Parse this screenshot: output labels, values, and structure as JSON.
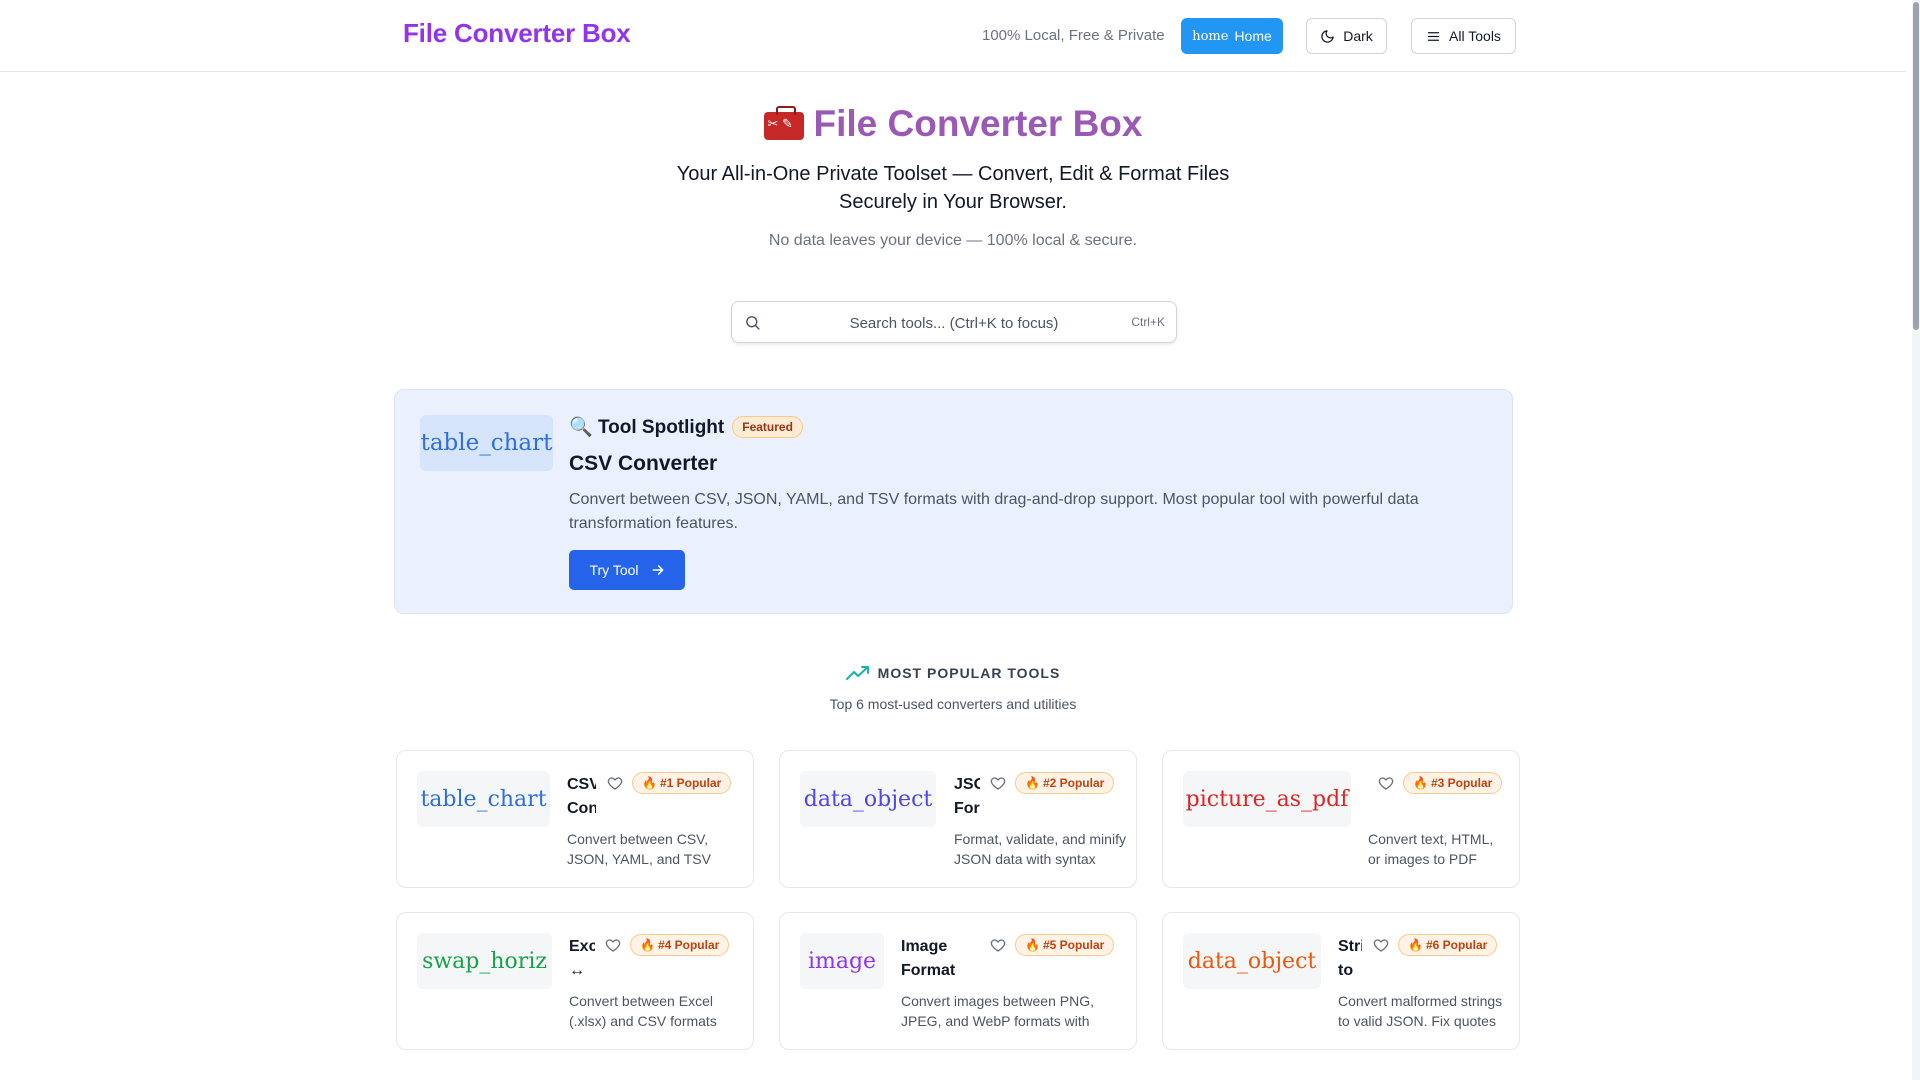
{
  "header": {
    "brand": "File Converter Box",
    "tagline": "100% Local, Free & Private",
    "home_icon_text": "home",
    "home_label": "Home",
    "dark_label": "Dark",
    "all_tools_label": "All Tools",
    "home_button_color": "#2196f3",
    "brand_color": "#9333ea"
  },
  "hero": {
    "title": "File Converter Box",
    "subtitle": "Your All-in-One Private Toolset — Convert, Edit & Format Files Securely in Your Browser.",
    "note": "No data leaves your device — 100% local & secure."
  },
  "search": {
    "placeholder": "Search tools... (Ctrl+K to focus)",
    "shortcut": "Ctrl+K"
  },
  "spotlight": {
    "icon_text": "table_chart",
    "heading": "Tool Spotlight",
    "heading_emoji": "🔍",
    "badge": "Featured",
    "tool_name": "CSV Converter",
    "description": "Convert between CSV, JSON, YAML, and TSV formats with drag-and-drop support. Most popular tool with powerful data transformation features.",
    "button_label": "Try Tool"
  },
  "popular": {
    "title": "MOST POPULAR TOOLS",
    "subtitle": "Top 6 most-used converters and utilities",
    "cards": [
      {
        "icon_text": "table_chart",
        "icon_color": "#2f6fd8",
        "name": "CSV Converter",
        "badge": "#1 Popular",
        "description": "Convert between CSV, JSON, YAML, and TSV formats with drag-and-drop support."
      },
      {
        "icon_text": "data_object",
        "icon_color": "#4f46e5",
        "name": "JSON Formatter",
        "badge": "#2 Popular",
        "description": "Format, validate, and minify JSON data with syntax highlighting."
      },
      {
        "icon_text": "picture_as_pdf",
        "icon_color": "#dc2626",
        "name": "",
        "badge": "#3 Popular",
        "description": "Convert text, HTML, or images to PDF documents."
      },
      {
        "icon_text": "swap_horiz",
        "icon_color": "#16a34a",
        "name": "Excel ↔ CSV",
        "badge": "#4 Popular",
        "description": "Convert between Excel (.xlsx) and CSV formats instantly."
      },
      {
        "icon_text": "image",
        "icon_color": "#9333ea",
        "name": "Image Format Converter",
        "badge": "#5 Popular",
        "description": "Convert images between PNG, JPEG, and WebP formats with quality control."
      },
      {
        "icon_text": "data_object",
        "icon_color": "#ea580c",
        "name": "String to JSON",
        "badge": "#6 Popular",
        "description": "Convert malformed strings to valid JSON. Fix quotes and escapes."
      }
    ]
  }
}
